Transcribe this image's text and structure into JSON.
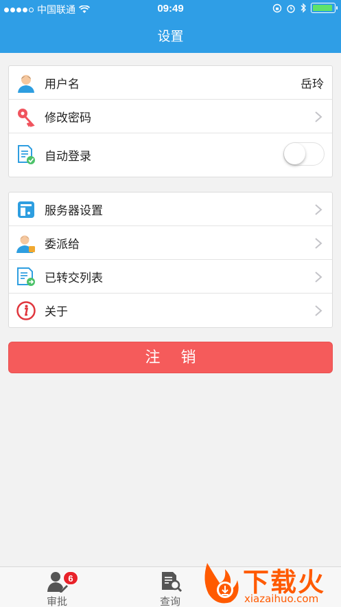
{
  "status_bar": {
    "carrier": "中国联通",
    "time": "09:49"
  },
  "nav": {
    "title": "设置"
  },
  "group1": [
    {
      "label": "用户名",
      "value": "岳玲",
      "icon": "user-icon"
    },
    {
      "label": "修改密码",
      "icon": "key-icon"
    },
    {
      "label": "自动登录",
      "icon": "auto-login-icon",
      "toggle_on": false
    }
  ],
  "group2": [
    {
      "label": "服务器设置",
      "icon": "server-icon"
    },
    {
      "label": "委派给",
      "icon": "delegate-icon"
    },
    {
      "label": "已转交列表",
      "icon": "transfer-list-icon"
    },
    {
      "label": "关于",
      "icon": "info-icon"
    }
  ],
  "logout_label": "注 销",
  "tabbar": {
    "tabs": [
      {
        "label": "审批",
        "badge": "6",
        "icon": "approve-icon"
      },
      {
        "label": "查询",
        "icon": "query-icon"
      }
    ]
  },
  "watermark": {
    "cn": "下载火",
    "en": "xiazaihuo.com"
  },
  "colors": {
    "nav_blue": "#2f9ee6",
    "logout_red": "#f55b5b",
    "badge_red": "#e8222a",
    "watermark_orange": "#ff5a00"
  }
}
